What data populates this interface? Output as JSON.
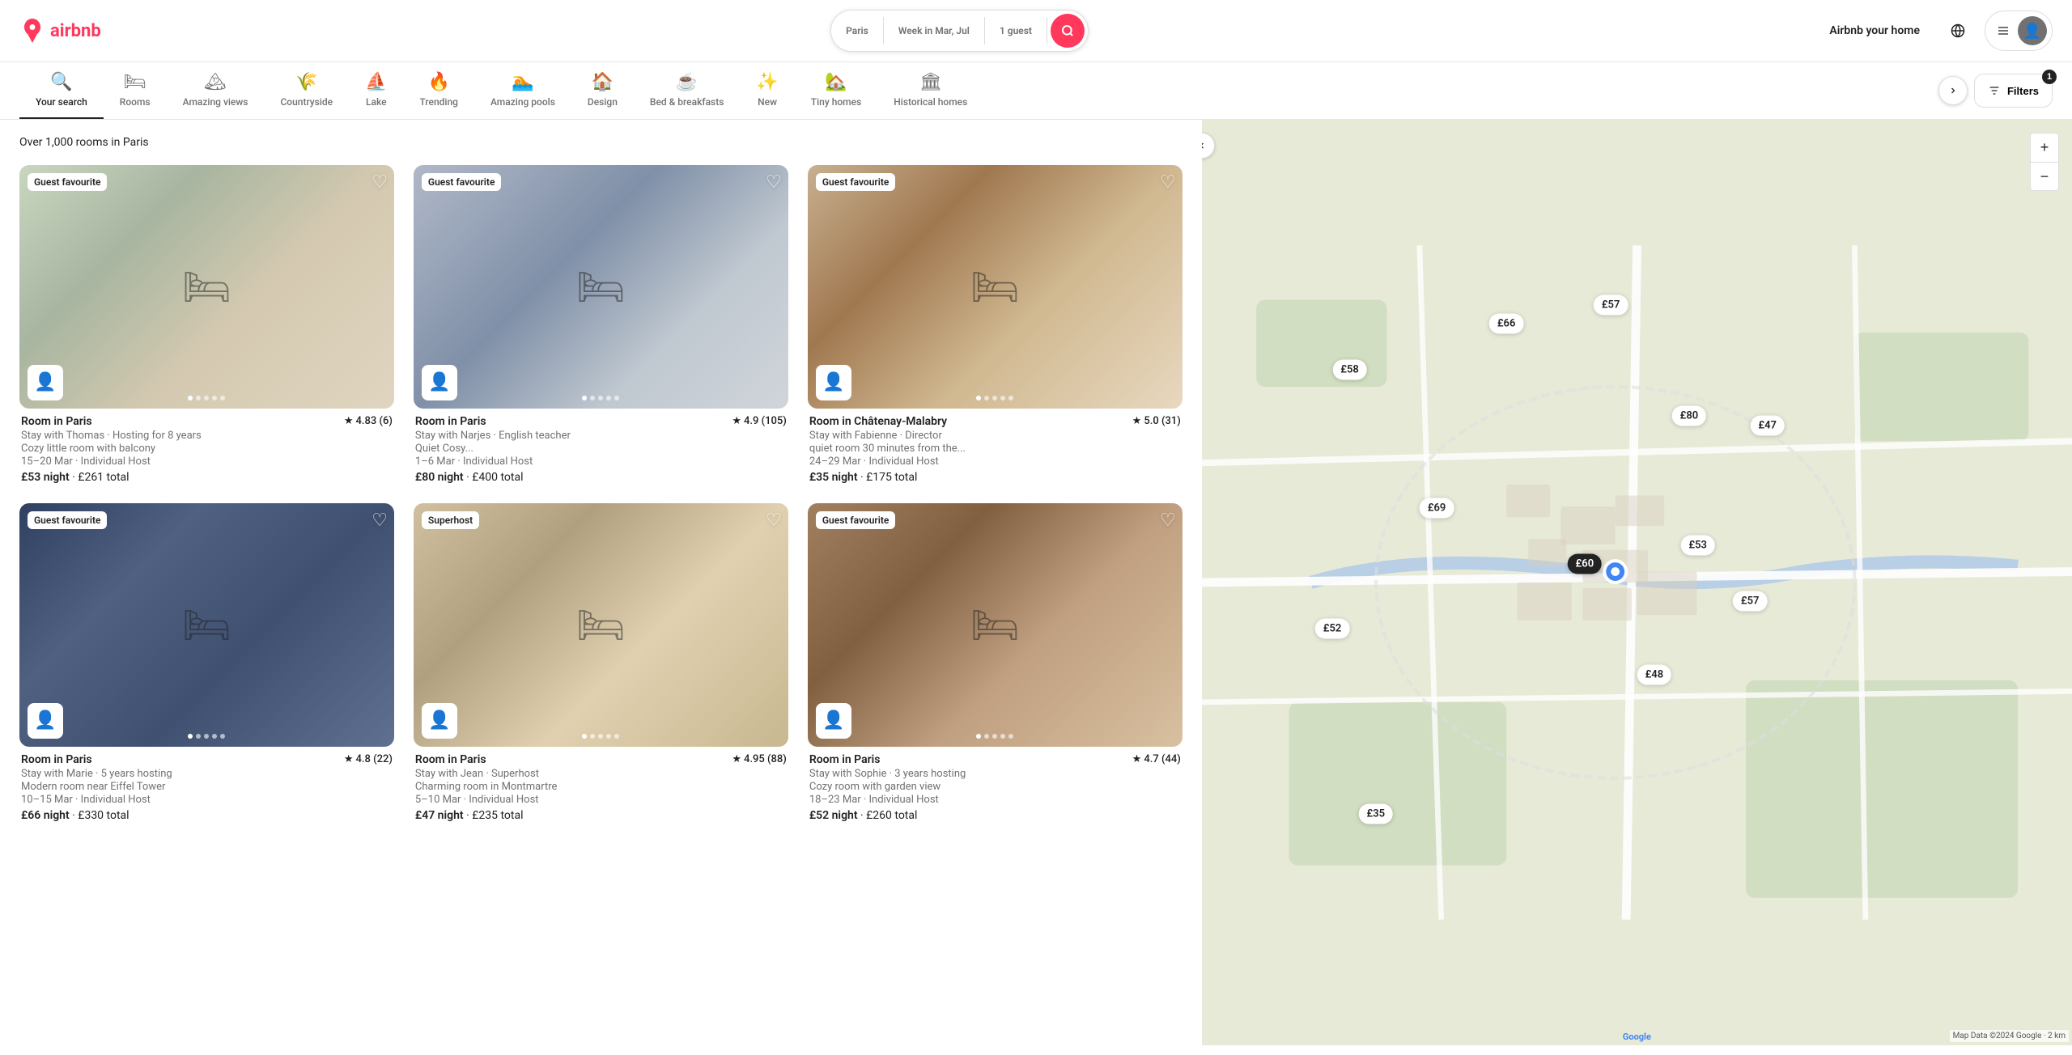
{
  "header": {
    "logo_text": "airbnb",
    "search": {
      "location": "Paris",
      "dates": "Week in Mar, Jul",
      "guests": "1 guest"
    },
    "nav": {
      "airbnb_home": "Airbnb your home",
      "filters_label": "Filters",
      "filter_count": "1"
    }
  },
  "categories": [
    {
      "id": "your-search",
      "icon": "🔍",
      "label": "Your search",
      "active": true
    },
    {
      "id": "rooms",
      "icon": "🛏",
      "label": "Rooms",
      "active": false
    },
    {
      "id": "amazing-views",
      "icon": "🏔",
      "label": "Amazing views",
      "active": false
    },
    {
      "id": "countryside",
      "icon": "🌾",
      "label": "Countryside",
      "active": false
    },
    {
      "id": "lake",
      "icon": "⛵",
      "label": "Lake",
      "active": false
    },
    {
      "id": "trending",
      "icon": "🔥",
      "label": "Trending",
      "active": false
    },
    {
      "id": "amazing-pools",
      "icon": "🏊",
      "label": "Amazing pools",
      "active": false
    },
    {
      "id": "design",
      "icon": "🏠",
      "label": "Design",
      "active": false
    },
    {
      "id": "bed-breakfasts",
      "icon": "☕",
      "label": "Bed & breakfasts",
      "active": false
    },
    {
      "id": "new",
      "icon": "✨",
      "label": "New",
      "active": false
    },
    {
      "id": "tiny-homes",
      "icon": "🏡",
      "label": "Tiny homes",
      "active": false
    },
    {
      "id": "historical-homes",
      "icon": "🏛",
      "label": "Historical homes",
      "active": false
    }
  ],
  "results_count": "Over 1,000 rooms in Paris",
  "listings": [
    {
      "id": 1,
      "badge": "Guest favourite",
      "title": "Room in Paris",
      "rating": "4.83",
      "review_count": "(6)",
      "subtitle": "Stay with Thomas · Hosting for 8 years",
      "description": "Cozy little room with balcony",
      "dates": "15–20 Mar · Individual Host",
      "price_night": "£53",
      "price_total": "£261 total",
      "img_class": "img-bg-1",
      "dots": [
        1,
        2,
        3,
        4,
        5
      ],
      "active_dot": 0
    },
    {
      "id": 2,
      "badge": "Guest favourite",
      "title": "Room in Paris",
      "rating": "4.9",
      "review_count": "(105)",
      "subtitle": "Stay with Narjes · English teacher",
      "description": "Quiet Cosy...",
      "dates": "1–6 Mar · Individual Host",
      "price_night": "£80",
      "price_total": "£400 total",
      "img_class": "img-bg-2",
      "dots": [
        1,
        2,
        3,
        4,
        5
      ],
      "active_dot": 0
    },
    {
      "id": 3,
      "badge": "Guest favourite",
      "title": "Room in Châtenay-Malabry",
      "rating": "5.0",
      "review_count": "(31)",
      "subtitle": "Stay with Fabienne · Director",
      "description": "quiet room 30 minutes from the...",
      "dates": "24–29 Mar · Individual Host",
      "price_night": "£35",
      "price_total": "£175 total",
      "img_class": "img-bg-3",
      "dots": [
        1,
        2,
        3,
        4,
        5
      ],
      "active_dot": 0
    },
    {
      "id": 4,
      "badge": "Guest favourite",
      "title": "Room in Paris",
      "rating": "4.8",
      "review_count": "(22)",
      "subtitle": "Stay with Marie · 5 years hosting",
      "description": "Modern room near Eiffel Tower",
      "dates": "10–15 Mar · Individual Host",
      "price_night": "£66",
      "price_total": "£330 total",
      "img_class": "img-bg-4",
      "dots": [
        1,
        2,
        3,
        4,
        5
      ],
      "active_dot": 0
    },
    {
      "id": 5,
      "badge": "Superhost",
      "title": "Room in Paris",
      "rating": "4.95",
      "review_count": "(88)",
      "subtitle": "Stay with Jean · Superhost",
      "description": "Charming room in Montmartre",
      "dates": "5–10 Mar · Individual Host",
      "price_night": "£47",
      "price_total": "£235 total",
      "img_class": "img-bg-5",
      "dots": [
        1,
        2,
        3,
        4,
        5
      ],
      "active_dot": 0
    },
    {
      "id": 6,
      "badge": "Guest favourite",
      "title": "Room in Paris",
      "rating": "4.7",
      "review_count": "(44)",
      "subtitle": "Stay with Sophie · 3 years hosting",
      "description": "Cozy room with garden view",
      "dates": "18–23 Mar · Individual Host",
      "price_night": "£52",
      "price_total": "£260 total",
      "img_class": "img-bg-6",
      "dots": [
        1,
        2,
        3,
        4,
        5
      ],
      "active_dot": 0
    }
  ],
  "map": {
    "price_pins": [
      {
        "id": "p58",
        "label": "£58",
        "left": "17%",
        "top": "27%",
        "active": false
      },
      {
        "id": "p66",
        "label": "£66",
        "left": "35%",
        "top": "22%",
        "active": false
      },
      {
        "id": "p57a",
        "label": "£57",
        "left": "47%",
        "top": "20%",
        "active": false
      },
      {
        "id": "p80",
        "label": "£80",
        "left": "56%",
        "top": "32%",
        "active": false
      },
      {
        "id": "p47",
        "label": "£47",
        "left": "65%",
        "top": "33%",
        "active": false
      },
      {
        "id": "p69",
        "label": "£69",
        "left": "27%",
        "top": "42%",
        "active": false
      },
      {
        "id": "p60",
        "label": "£60",
        "left": "44%",
        "top": "48%",
        "active": true
      },
      {
        "id": "p53",
        "label": "£53",
        "left": "57%",
        "top": "46%",
        "active": false
      },
      {
        "id": "p57b",
        "label": "£57",
        "left": "63%",
        "top": "52%",
        "active": false
      },
      {
        "id": "p52",
        "label": "£52",
        "left": "15%",
        "top": "55%",
        "active": false
      },
      {
        "id": "p48",
        "label": "£48",
        "left": "52%",
        "top": "60%",
        "active": false
      },
      {
        "id": "p35",
        "label": "£35",
        "left": "20%",
        "top": "75%",
        "active": false
      }
    ]
  }
}
